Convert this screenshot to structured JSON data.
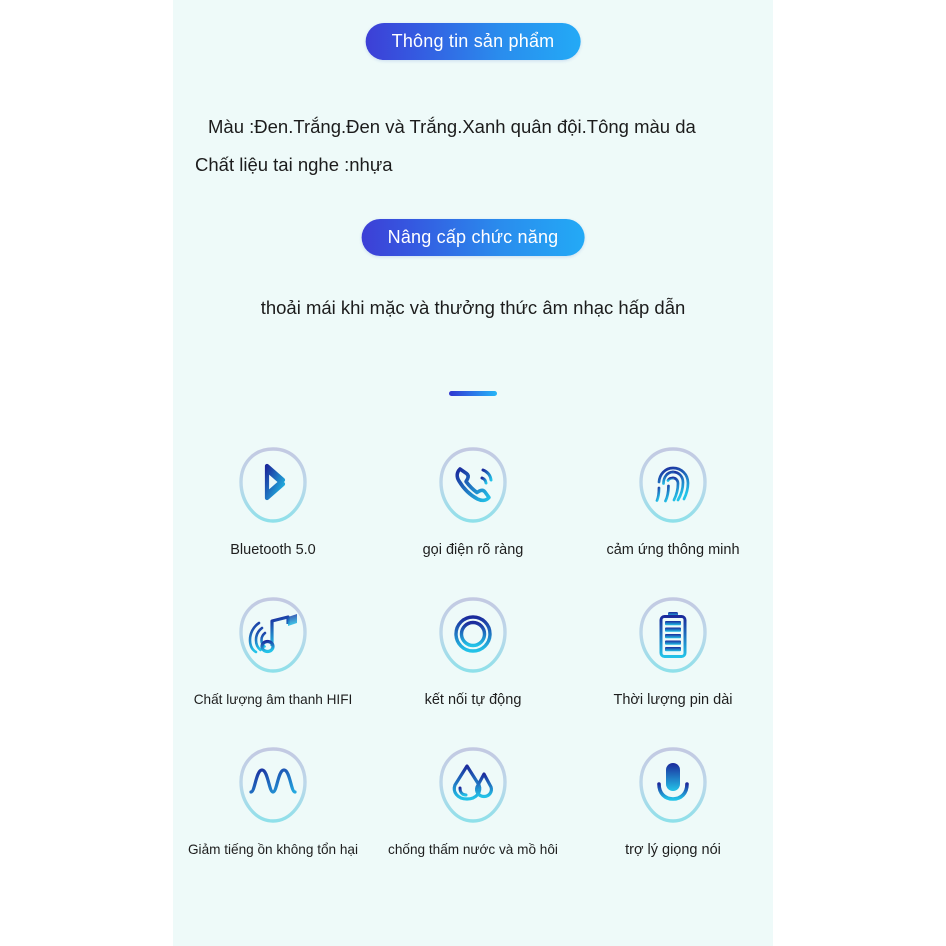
{
  "page": {
    "background_color": "#ffffff",
    "panel_color": "#eefaf9"
  },
  "badges": {
    "product_info": "Thông tin sản phẩm",
    "function_upgrade": "Nâng cấp chức năng",
    "gradient_from": "#3d3fd6",
    "gradient_to": "#23aaf6"
  },
  "specs": {
    "color_line": "Màu :Đen.Trắng.Đen và Trắng.Xanh quân đội.Tông màu da",
    "material_line": "Chất liệu tai nghe :nhựa"
  },
  "tagline": "thoải mái khi mặc và thưởng thức âm nhạc hấp dẫn",
  "features": [
    {
      "icon": "bluetooth-icon",
      "label": "Bluetooth 5.0"
    },
    {
      "icon": "phone-call-icon",
      "label": "gọi điện rõ ràng"
    },
    {
      "icon": "fingerprint-icon",
      "label": "cảm ứng thông minh"
    },
    {
      "icon": "music-hifi-icon",
      "label": "Chất lượng âm thanh HIFI"
    },
    {
      "icon": "power-icon",
      "label": "kết nối tự động"
    },
    {
      "icon": "battery-icon",
      "label": "Thời lượng pin dài"
    },
    {
      "icon": "waveform-icon",
      "label": "Giảm tiếng ồn không tổn hại"
    },
    {
      "icon": "water-drop-icon",
      "label": "chống thấm nước và mồ hôi"
    },
    {
      "icon": "microphone-icon",
      "label": "trợ lý giọng nói"
    }
  ]
}
